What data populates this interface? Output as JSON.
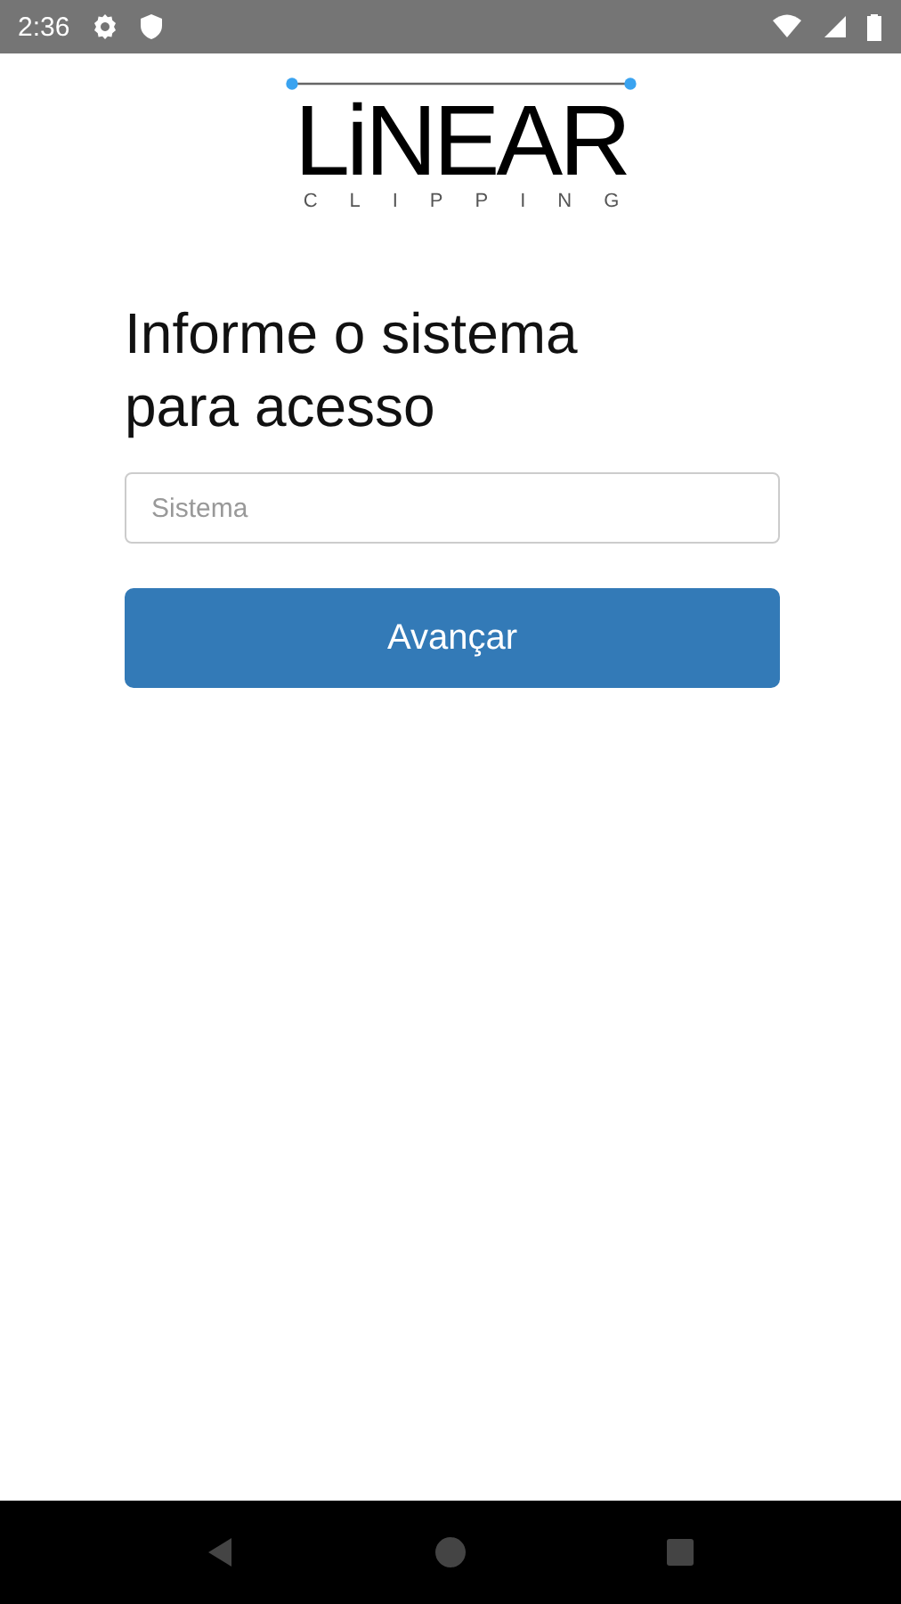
{
  "status_bar": {
    "time": "2:36"
  },
  "logo": {
    "title": "LiNEAR",
    "subtitle": "CLIPPING"
  },
  "heading": "Informe o sistema para acesso",
  "field": {
    "placeholder": "Sistema"
  },
  "button": "Avançar"
}
